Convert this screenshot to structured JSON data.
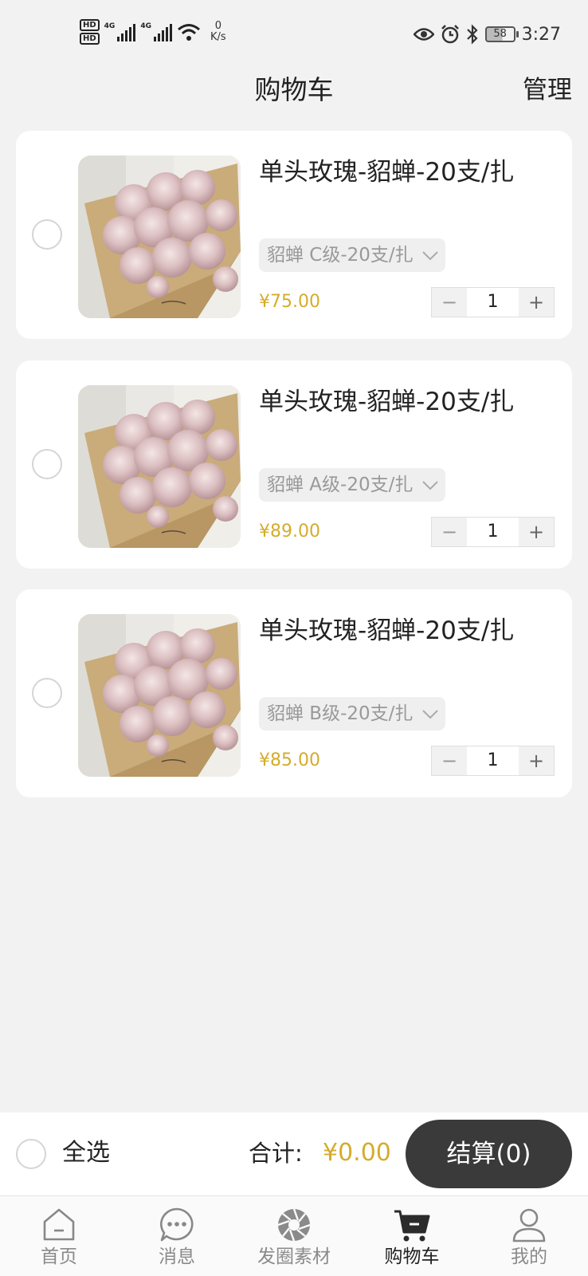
{
  "status_bar": {
    "sim1": "HD",
    "sim2": "HD",
    "net1": "4G",
    "net2": "4G",
    "speed_value": "0",
    "speed_unit": "K/s",
    "battery": "58",
    "time": "3:27",
    "icons": [
      "signal-icon",
      "wifi-icon",
      "eye-icon",
      "alarm-icon",
      "bluetooth-icon",
      "battery-icon"
    ]
  },
  "header": {
    "title": "购物车",
    "manage": "管理"
  },
  "cart": {
    "items": [
      {
        "name": "单头玫瑰-貂蝉-20支/扎",
        "spec": "貂蝉 C级-20支/扎",
        "price": "¥75.00",
        "qty": "1"
      },
      {
        "name": "单头玫瑰-貂蝉-20支/扎",
        "spec": "貂蝉 A级-20支/扎",
        "price": "¥89.00",
        "qty": "1"
      },
      {
        "name": "单头玫瑰-貂蝉-20支/扎",
        "spec": "貂蝉 B级-20支/扎",
        "price": "¥85.00",
        "qty": "1"
      }
    ],
    "minus": "−",
    "plus": "+"
  },
  "footer": {
    "select_all": "全选",
    "total_label": "合计:",
    "total_value": "¥0.00",
    "checkout": "结算(0)"
  },
  "tabbar": {
    "tabs": [
      {
        "label": "首页",
        "icon": "home-icon"
      },
      {
        "label": "消息",
        "icon": "chat-icon"
      },
      {
        "label": "发圈素材",
        "icon": "aperture-icon"
      },
      {
        "label": "购物车",
        "icon": "cart-icon",
        "active": true
      },
      {
        "label": "我的",
        "icon": "user-icon"
      }
    ]
  },
  "colors": {
    "accent_price": "#d4ac2c",
    "checkout_bg": "#3a3a3a",
    "page_bg": "#f2f2f2"
  }
}
